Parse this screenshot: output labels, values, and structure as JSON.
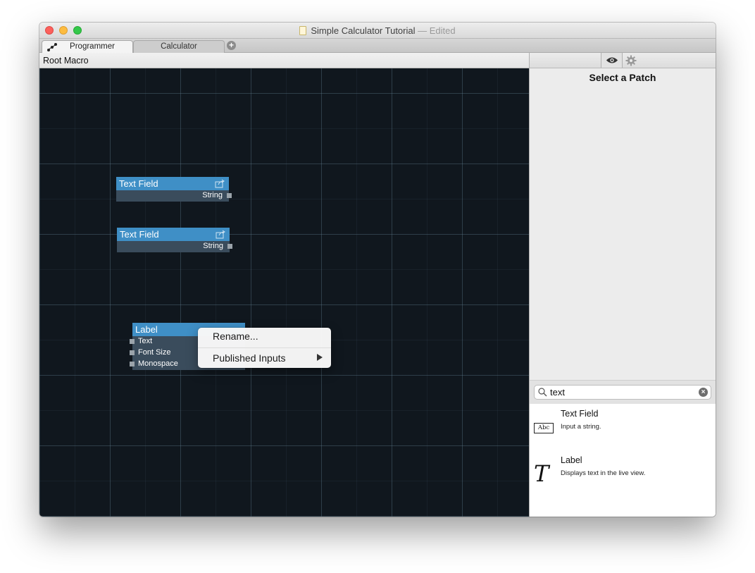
{
  "window": {
    "title": "Simple Calculator Tutorial",
    "title_separator": "—",
    "title_status": "Edited"
  },
  "tabs": [
    {
      "label": "Programmer",
      "active": true
    },
    {
      "label": "Calculator",
      "active": false
    }
  ],
  "add_tab_symbol": "+",
  "breadcrumb": "Root Macro",
  "canvas": {
    "patches": [
      {
        "title": "Text Field",
        "output": "String"
      },
      {
        "title": "Text Field",
        "output": "String"
      },
      {
        "title": "Label",
        "inputs": [
          "Text",
          "Font Size",
          "Monospace"
        ]
      }
    ],
    "context_menu": {
      "items": [
        {
          "label": "Rename...",
          "has_submenu": false
        },
        {
          "label": "Published Inputs",
          "has_submenu": true
        }
      ]
    }
  },
  "inspector": {
    "title": "Select a Patch",
    "toolbar_icons": [
      "eye-icon",
      "gear-icon"
    ]
  },
  "library": {
    "search": {
      "value": "text"
    },
    "results": [
      {
        "name": "Text Field",
        "description": "Input a string.",
        "icon": "abc-icon",
        "icon_text": "Abc"
      },
      {
        "name": "Label",
        "description": "Displays text in the live view.",
        "icon": "italic-t-icon",
        "icon_text": "T"
      }
    ]
  },
  "colors": {
    "canvas_background": "#10171e",
    "patch_header": "#3f8fc6",
    "patch_body": "#3a4c5c",
    "close": "#fc605c",
    "minimize": "#fdbc40",
    "zoom": "#34c84a"
  }
}
